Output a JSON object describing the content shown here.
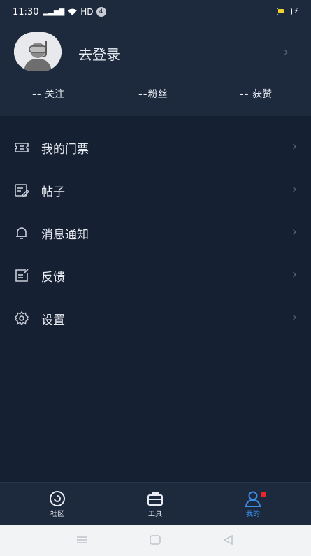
{
  "status": {
    "time": "11:30",
    "network": "HD",
    "badge": "4"
  },
  "profile": {
    "login_text": "去登录"
  },
  "stats": [
    {
      "value": "--",
      "label": "关注"
    },
    {
      "value": "--",
      "label": "粉丝"
    },
    {
      "value": "--",
      "label": "获赞"
    }
  ],
  "menu": [
    {
      "label": "我的门票",
      "icon": "ticket-icon"
    },
    {
      "label": "帖子",
      "icon": "post-icon"
    },
    {
      "label": "消息通知",
      "icon": "bell-icon"
    },
    {
      "label": "反馈",
      "icon": "feedback-icon"
    },
    {
      "label": "设置",
      "icon": "gear-icon"
    }
  ],
  "tabs": [
    {
      "label": "社区",
      "icon": "community-icon"
    },
    {
      "label": "工具",
      "icon": "toolbox-icon"
    },
    {
      "label": "我的",
      "icon": "user-icon",
      "active": true
    }
  ],
  "colors": {
    "accent": "#3b8de8",
    "background": "#162033",
    "header": "#1d2a3e",
    "notify_dot": "#e8262b"
  }
}
